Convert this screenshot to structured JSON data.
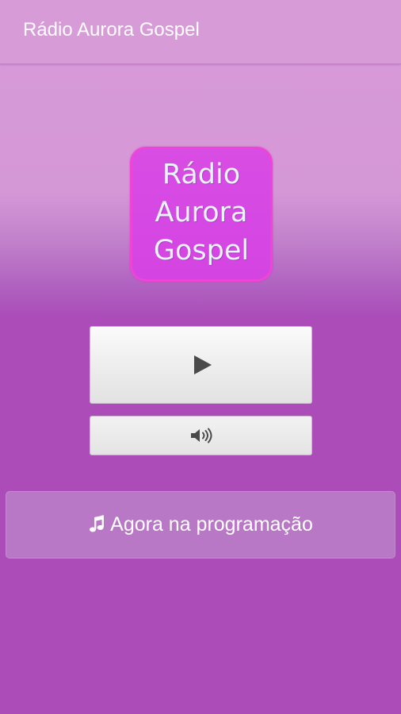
{
  "app_bar": {
    "title": "Rádio Aurora Gospel"
  },
  "logo": {
    "lines": [
      "Rádio",
      "Aurora",
      "Gospel"
    ]
  },
  "player": {
    "play_icon": "play-icon",
    "volume_icon": "volume-icon"
  },
  "now_playing": {
    "icon": "music-note-icon",
    "label": "Agora na programação"
  },
  "colors": {
    "app_bar": "#d79bd8",
    "background_top": "#d89ad8",
    "background_bottom": "#ab4cb9",
    "logo_fill": "#d84de4",
    "logo_border": "#ee44d8",
    "logo_text": "#e9f3fb",
    "now_playing_fill": "#b978c6"
  }
}
